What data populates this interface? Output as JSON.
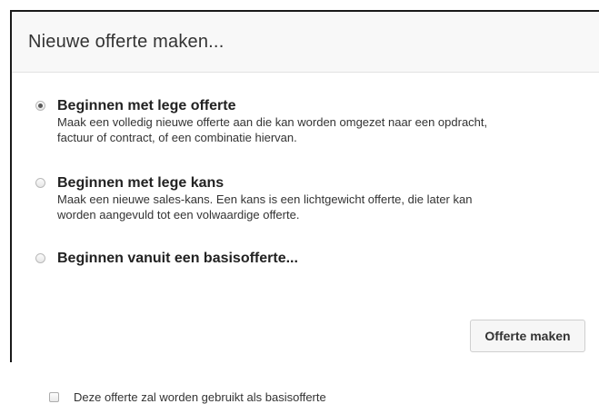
{
  "dialog": {
    "title": "Nieuwe offerte maken..."
  },
  "options": [
    {
      "title": "Beginnen met lege offerte",
      "description_line1": "Maak een volledig nieuwe offerte aan die kan worden omgezet naar een opdracht,",
      "description_line2": "factuur of contract, of een combinatie hiervan.",
      "selected": true
    },
    {
      "title": "Beginnen met lege kans",
      "description_line1": "Maak een nieuwe sales-kans. Een kans is een lichtgewicht offerte, die later kan",
      "description_line2": "worden aangevuld tot een volwaardige offerte.",
      "selected": false
    },
    {
      "title": "Beginnen vanuit een basisofferte...",
      "selected": false
    }
  ],
  "footer": {
    "checkbox_label": "Deze offerte zal worden gebruikt als basisofferte",
    "checkbox_checked": false,
    "submit_label": "Offerte maken"
  }
}
